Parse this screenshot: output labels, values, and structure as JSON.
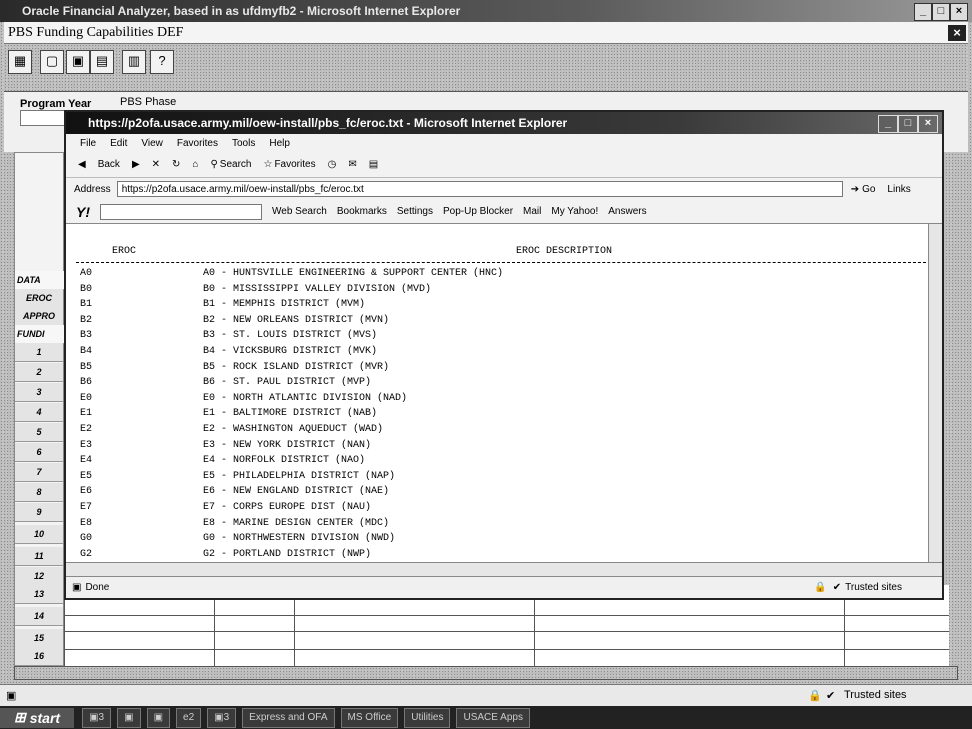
{
  "outer": {
    "title": "Oracle Financial Analyzer, based in as ufdmyfb2 - Microsoft Internet Explorer",
    "app_title": "PBS Funding Capabilities DEF",
    "program_label": "Program Year",
    "pbs_label": "PBS Phase",
    "status_zone": "Trusted sites"
  },
  "left_rows": [
    {
      "label": "DATA",
      "section": true
    },
    {
      "label": "EROC",
      "section": false
    },
    {
      "label": "APPRO",
      "section": false
    },
    {
      "label": "FUNDI",
      "section": true
    },
    {
      "label": "1",
      "section": false
    },
    {
      "label": "2",
      "section": false
    },
    {
      "label": "3",
      "section": false
    },
    {
      "label": "4",
      "section": false
    },
    {
      "label": "5",
      "section": false
    },
    {
      "label": "6",
      "section": false
    },
    {
      "label": "7",
      "section": false
    },
    {
      "label": "8",
      "section": false
    },
    {
      "label": "9",
      "section": false
    },
    {
      "label": "10",
      "section": false
    },
    {
      "label": "11",
      "section": false
    },
    {
      "label": "12",
      "section": false
    },
    {
      "label": "13",
      "section": false
    },
    {
      "label": "14",
      "section": false
    },
    {
      "label": "15",
      "section": false
    },
    {
      "label": "16",
      "section": false
    }
  ],
  "ie": {
    "title": "https://p2ofa.usace.army.mil/oew-install/pbs_fc/eroc.txt - Microsoft Internet Explorer",
    "menu": [
      "File",
      "Edit",
      "View",
      "Favorites",
      "Tools",
      "Help"
    ],
    "toolbar": {
      "back": "Back",
      "search": "Search",
      "favorites": "Favorites"
    },
    "address_label": "Address",
    "address": "https://p2ofa.usace.army.mil/oew-install/pbs_fc/eroc.txt",
    "go": "Go",
    "links": "Links",
    "yahoo": [
      "Web Search",
      "Bookmarks",
      "Settings",
      "Pop-Up Blocker",
      "Mail",
      "My Yahoo!",
      "Answers"
    ],
    "status_left": "Done",
    "status_right": "Trusted sites"
  },
  "eroc_header": {
    "code": "EROC",
    "desc": "EROC DESCRIPTION"
  },
  "eroc_rows": [
    {
      "code": "A0",
      "desc": "A0 - HUNTSVILLE ENGINEERING & SUPPORT CENTER (HNC)"
    },
    {
      "code": "B0",
      "desc": "B0 - MISSISSIPPI VALLEY DIVISION (MVD)"
    },
    {
      "code": "B1",
      "desc": "B1 - MEMPHIS DISTRICT (MVM)"
    },
    {
      "code": "B2",
      "desc": "B2 - NEW ORLEANS DISTRICT (MVN)"
    },
    {
      "code": "B3",
      "desc": "B3 - ST. LOUIS DISTRICT (MVS)"
    },
    {
      "code": "B4",
      "desc": "B4 - VICKSBURG DISTRICT (MVK)"
    },
    {
      "code": "B5",
      "desc": "B5 - ROCK ISLAND DISTRICT (MVR)"
    },
    {
      "code": "B6",
      "desc": "B6 - ST. PAUL DISTRICT (MVP)"
    },
    {
      "code": "E0",
      "desc": "E0 - NORTH ATLANTIC DIVISION (NAD)"
    },
    {
      "code": "E1",
      "desc": "E1 - BALTIMORE DISTRICT (NAB)"
    },
    {
      "code": "E2",
      "desc": "E2 - WASHINGTON AQUEDUCT (WAD)"
    },
    {
      "code": "E3",
      "desc": "E3 - NEW YORK DISTRICT (NAN)"
    },
    {
      "code": "E4",
      "desc": "E4 - NORFOLK DISTRICT (NAO)"
    },
    {
      "code": "E5",
      "desc": "E5 - PHILADELPHIA DISTRICT (NAP)"
    },
    {
      "code": "E6",
      "desc": "E6 - NEW ENGLAND DISTRICT (NAE)"
    },
    {
      "code": "E7",
      "desc": "E7 - CORPS EUROPE DIST (NAU)"
    },
    {
      "code": "E8",
      "desc": "E8 - MARINE DESIGN CENTER (MDC)"
    },
    {
      "code": "G0",
      "desc": "G0 - NORTHWESTERN DIVISION (NWD)"
    },
    {
      "code": "G2",
      "desc": "G2 - PORTLAND DISTRICT (NWP)"
    }
  ],
  "taskbar": {
    "start": "start",
    "items": [
      "3",
      "",
      "",
      "2",
      "3",
      "Express and OFA",
      "MS Office",
      "Utilities",
      "USACE Apps"
    ]
  }
}
